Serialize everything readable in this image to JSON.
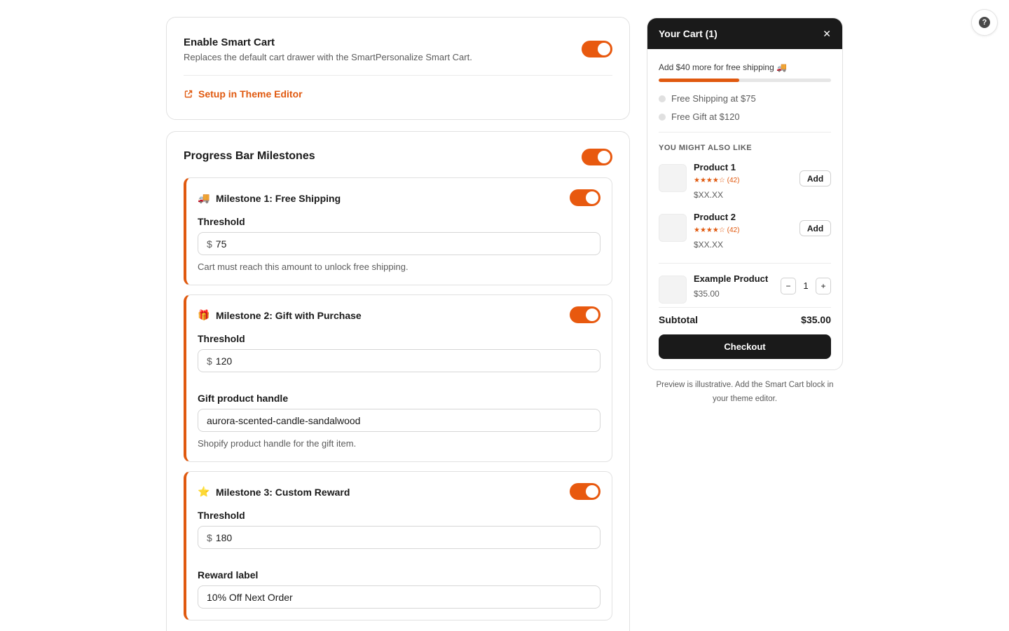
{
  "help": {
    "icon": "question-circle-icon",
    "glyph": "?"
  },
  "smart_cart": {
    "title": "Enable Smart Cart",
    "description": "Replaces the default cart drawer with the SmartPersonalize Smart Cart.",
    "enabled": true,
    "setup_link": "Setup in Theme Editor"
  },
  "progress": {
    "title": "Progress Bar Milestones",
    "enabled": true,
    "milestones": [
      {
        "emoji": "🚚",
        "title": "Milestone 1: Free Shipping",
        "enabled": true,
        "threshold_label": "Threshold",
        "currency": "$",
        "threshold": "75",
        "help": "Cart must reach this amount to unlock free shipping."
      },
      {
        "emoji": "🎁",
        "title": "Milestone 2: Gift with Purchase",
        "enabled": true,
        "threshold_label": "Threshold",
        "currency": "$",
        "threshold": "120",
        "handle_label": "Gift product handle",
        "handle": "aurora-scented-candle-sandalwood",
        "help": "Shopify product handle for the gift item."
      },
      {
        "emoji": "⭐",
        "title": "Milestone 3: Custom Reward",
        "enabled": true,
        "threshold_label": "Threshold",
        "currency": "$",
        "threshold": "180",
        "reward_label_label": "Reward label",
        "reward_label": "10% Off Next Order"
      }
    ]
  },
  "cart": {
    "title": "Your Cart (1)",
    "close": "✕",
    "shipping_message": "Add $40 more for free shipping 🚚",
    "progress_fraction": 0.467,
    "milestone_rows": [
      "Free Shipping at $75",
      "Free Gift at $120"
    ],
    "upsell_heading": "YOU MIGHT ALSO LIKE",
    "upsell": [
      {
        "name": "Product 1",
        "stars": "★★★★☆",
        "reviews": "(42)",
        "price": "$XX.XX",
        "button": "Add"
      },
      {
        "name": "Product 2",
        "stars": "★★★★☆",
        "reviews": "(42)",
        "price": "$XX.XX",
        "button": "Add"
      }
    ],
    "item": {
      "name": "Example Product",
      "price": "$35.00",
      "qty": "1",
      "minus": "−",
      "plus": "+"
    },
    "subtotal_label": "Subtotal",
    "subtotal_value": "$35.00",
    "checkout": "Checkout",
    "accent": "#e0590f"
  },
  "preview_note": "Preview is illustrative. Add the Smart Cart block in your theme editor."
}
